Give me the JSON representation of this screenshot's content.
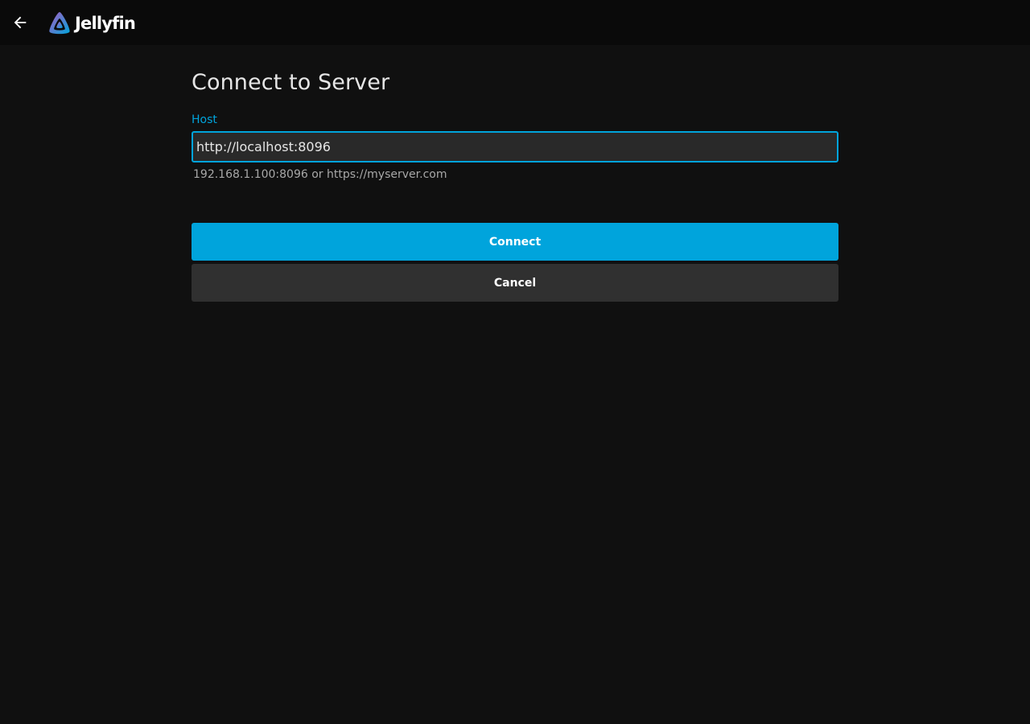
{
  "header": {
    "brand_name": "Jellyfin",
    "back_icon": "arrow-left-icon",
    "logo_icon": "jellyfin-logo-icon"
  },
  "form": {
    "title": "Connect to Server",
    "host_label": "Host",
    "host_value": "http://localhost:8096",
    "host_hint": "192.168.1.100:8096 or https://myserver.com",
    "connect_label": "Connect",
    "cancel_label": "Cancel"
  },
  "colors": {
    "accent": "#00a4dc",
    "background": "#101010",
    "header_background": "#0a0a0a",
    "input_background": "#292929",
    "secondary_button": "#303030"
  }
}
